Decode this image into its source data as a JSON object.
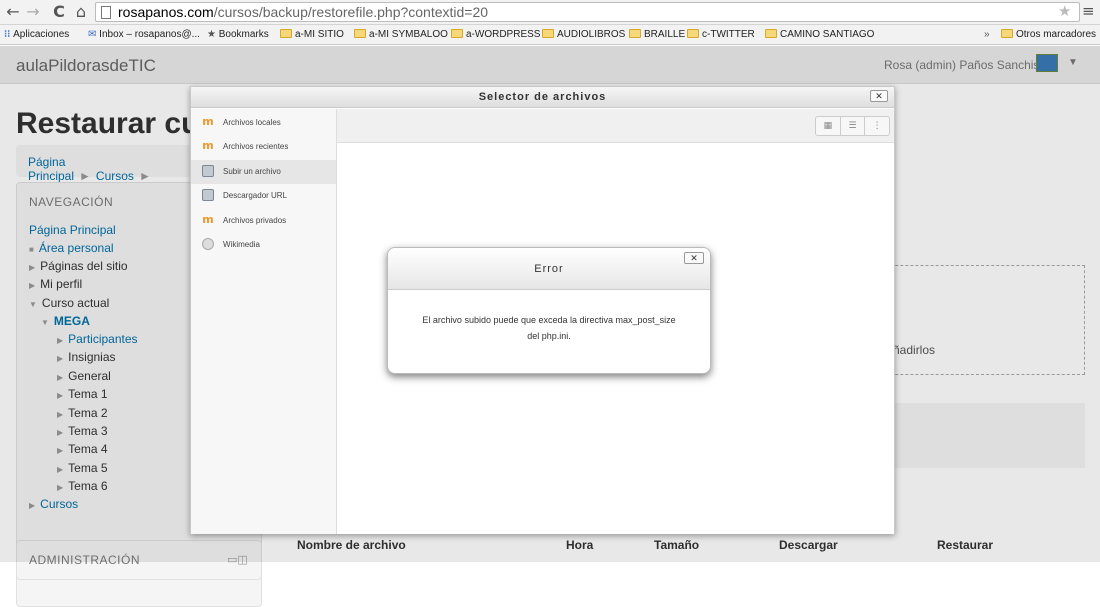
{
  "browser": {
    "url_host": "rosapanos.com",
    "url_path": "/cursos/backup/restorefile.php?contextid=20",
    "nav": {
      "back": "←",
      "forward": "→",
      "reload": "C",
      "home": "⌂"
    },
    "bookmarks": [
      "Aplicaciones",
      "Inbox – rosapanos@...",
      "Bookmarks",
      "a-MI SITIO",
      "a-MI SYMBALOO",
      "a-WORDPRESS",
      "AUDIOLIBROS",
      "BRAILLE",
      "c-TWITTER",
      "CAMINO SANTIAGO"
    ],
    "overflow": "»",
    "other_bookmarks": "Otros marcadores"
  },
  "header": {
    "site_name": "aulaPildorasdeTIC",
    "user_name": "Rosa (admin) Paños Sanchis"
  },
  "page": {
    "title": "Restaurar curs",
    "breadcrumb": [
      "Página Principal",
      "Cursos"
    ],
    "navigation": {
      "title": "NAVEGACIÓN",
      "items": [
        "Página Principal",
        "Área personal",
        "Páginas del sitio",
        "Mi perfil",
        "Curso actual",
        "MEGA",
        "Participantes",
        "Insignias",
        "General",
        "Tema 1",
        "Tema 2",
        "Tema 3",
        "Tema 4",
        "Tema 5",
        "Tema 6",
        "Cursos"
      ]
    },
    "admin_title": "ADMINISTRACIÓN",
    "dropzone_text": "ñadirlos",
    "table_headers": [
      "Nombre de archivo",
      "Hora",
      "Tamaño",
      "Descargar",
      "Restaurar"
    ]
  },
  "picker": {
    "title": "Selector de archivos",
    "repos": [
      {
        "label": "Archivos locales",
        "icon": "moodle-icon"
      },
      {
        "label": "Archivos recientes",
        "icon": "moodle-icon"
      },
      {
        "label": "Subir un archivo",
        "icon": "upload-icon"
      },
      {
        "label": "Descargador URL",
        "icon": "url-icon"
      },
      {
        "label": "Archivos privados",
        "icon": "moodle-icon"
      },
      {
        "label": "Wikimedia",
        "icon": "wikimedia-icon"
      }
    ],
    "active_repo": "Subir un archivo"
  },
  "error": {
    "title": "Error",
    "message_line1": "El archivo subido puede que exceda la directiva max_post_size",
    "message_line2": "del php.ini."
  }
}
